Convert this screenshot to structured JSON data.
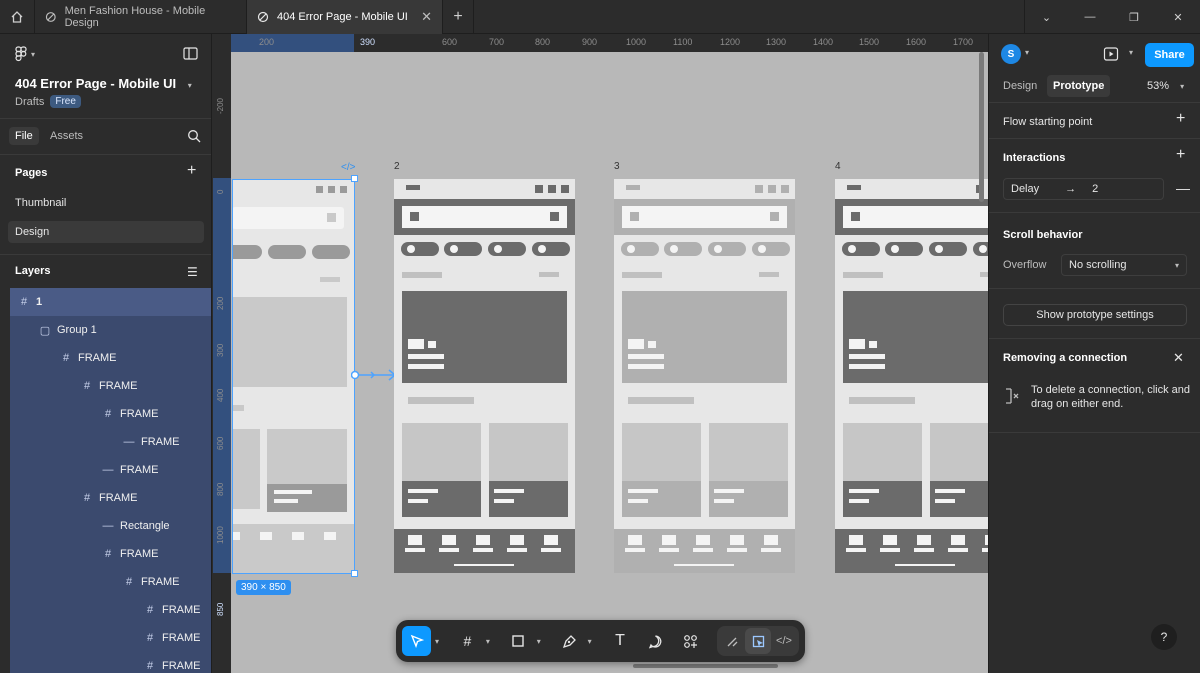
{
  "tabs": [
    {
      "label": "Men Fashion House - Mobile Design",
      "active": false
    },
    {
      "label": "404 Error Page - Mobile UI",
      "active": true
    }
  ],
  "left": {
    "project_title": "404 Error Page - Mobile UI",
    "drafts_label": "Drafts",
    "plan_badge": "Free",
    "file_tab": "File",
    "assets_tab": "Assets",
    "pages_header": "Pages",
    "pages": [
      "Thumbnail",
      "Design"
    ],
    "layers_header": "Layers",
    "layers": [
      {
        "name": "1",
        "icon": "#",
        "indent": 0
      },
      {
        "name": "Group 1",
        "icon": "▢",
        "indent": 1
      },
      {
        "name": "FRAME",
        "icon": "#",
        "indent": 2
      },
      {
        "name": "FRAME",
        "icon": "#",
        "indent": 3
      },
      {
        "name": "FRAME",
        "icon": "#",
        "indent": 4
      },
      {
        "name": "FRAME",
        "icon": "—",
        "indent": 5
      },
      {
        "name": "FRAME",
        "icon": "—",
        "indent": 4
      },
      {
        "name": "FRAME",
        "icon": "#",
        "indent": 3
      },
      {
        "name": "Rectangle",
        "icon": "—",
        "indent": 4
      },
      {
        "name": "FRAME",
        "icon": "#",
        "indent": 4
      },
      {
        "name": "FRAME",
        "icon": "#",
        "indent": 5
      },
      {
        "name": "FRAME",
        "icon": "#",
        "indent": 6
      },
      {
        "name": "FRAME",
        "icon": "#",
        "indent": 6
      },
      {
        "name": "FRAME",
        "icon": "#",
        "indent": 6
      }
    ]
  },
  "canvas": {
    "ruler_top": [
      "200",
      "390",
      "600",
      "700",
      "800",
      "900",
      "1000",
      "1100",
      "1200",
      "1300",
      "1400",
      "1500",
      "1600",
      "1700"
    ],
    "ruler_left": [
      "-200",
      "0",
      "200",
      "300",
      "400",
      "600",
      "800",
      "1000",
      "850"
    ],
    "frame_labels": [
      "2",
      "3",
      "4"
    ],
    "selection_size": "390 × 850"
  },
  "right": {
    "avatar_initial": "S",
    "share_label": "Share",
    "design_tab": "Design",
    "prototype_tab": "Prototype",
    "zoom": "53%",
    "flow_starting_point": "Flow starting point",
    "interactions_header": "Interactions",
    "interaction_trigger": "Delay",
    "interaction_arrow": "→",
    "interaction_target": "2",
    "scroll_header": "Scroll behavior",
    "overflow_label": "Overflow",
    "overflow_value": "No scrolling",
    "show_settings": "Show prototype settings",
    "removing_title": "Removing a connection",
    "removing_text": "To delete a connection, click and drag on either end."
  },
  "colors": {
    "accent": "#0d99ff",
    "selection": "#4da3ff",
    "layer_highlight": "#3b4a6e",
    "canvas_bg": "#b8b8b8"
  }
}
